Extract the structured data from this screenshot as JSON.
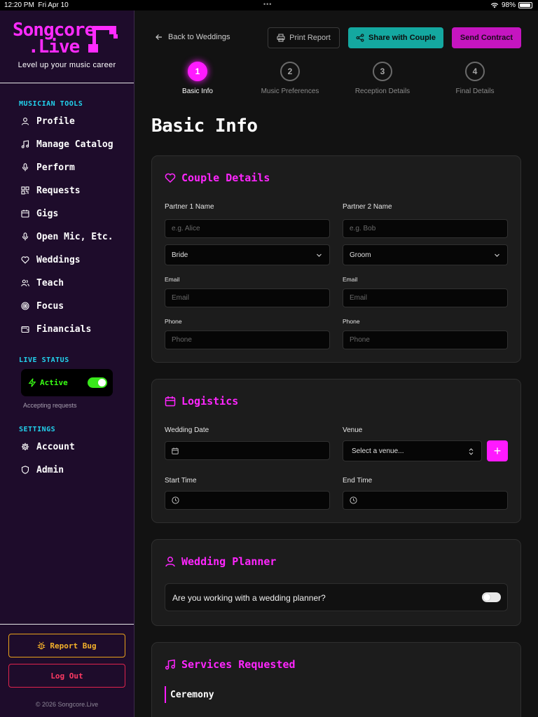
{
  "status_bar": {
    "time": "12:20 PM",
    "date": "Fri Apr 10",
    "battery": "98%",
    "battery_level": 0.98
  },
  "sidebar": {
    "logo_line1": "Songcore",
    "logo_line2": ".Live",
    "tagline": "Level up your music career",
    "musician_tools_heading": "MUSICIAN TOOLS",
    "items": [
      {
        "label": "Profile",
        "icon": "user-icon"
      },
      {
        "label": "Manage Catalog",
        "icon": "music-note-icon"
      },
      {
        "label": "Perform",
        "icon": "microphone-icon"
      },
      {
        "label": "Requests",
        "icon": "qr-code-icon"
      },
      {
        "label": "Gigs",
        "icon": "calendar-icon"
      },
      {
        "label": "Open Mic, Etc.",
        "icon": "microphone-icon"
      },
      {
        "label": "Weddings",
        "icon": "heart-icon"
      },
      {
        "label": "Teach",
        "icon": "users-icon"
      },
      {
        "label": "Focus",
        "icon": "target-icon"
      },
      {
        "label": "Financials",
        "icon": "wallet-icon"
      }
    ],
    "live_status_heading": "LIVE STATUS",
    "live_status_label": "Active",
    "live_status_on": true,
    "accepting_text": "Accepting requests",
    "settings_heading": "SETTINGS",
    "settings_items": [
      {
        "label": "Account",
        "icon": "gear-icon"
      },
      {
        "label": "Admin",
        "icon": "shield-icon"
      }
    ],
    "report_bug": "Report Bug",
    "log_out": "Log Out",
    "copyright": "© 2026 Songcore.Live"
  },
  "header": {
    "back_label": "Back to Weddings",
    "print_label": "Print Report",
    "share_label": "Share with Couple",
    "contract_label": "Send Contract"
  },
  "steps": [
    {
      "num": "1",
      "label": "Basic Info",
      "active": true
    },
    {
      "num": "2",
      "label": "Music Preferences",
      "active": false
    },
    {
      "num": "3",
      "label": "Reception Details",
      "active": false
    },
    {
      "num": "4",
      "label": "Final Details",
      "active": false
    }
  ],
  "page_title": "Basic Info",
  "couple": {
    "title": "Couple Details",
    "p1_label": "Partner 1 Name",
    "p2_label": "Partner 2 Name",
    "p1_placeholder": "e.g. Alice",
    "p2_placeholder": "e.g. Bob",
    "p1_role": "Bride",
    "p2_role": "Groom",
    "email_label": "Email",
    "email_placeholder": "Email",
    "phone_label": "Phone",
    "phone_placeholder": "Phone"
  },
  "logistics": {
    "title": "Logistics",
    "date_label": "Wedding Date",
    "venue_label": "Venue",
    "venue_placeholder": "Select a venue...",
    "add_label": "+",
    "start_label": "Start Time",
    "end_label": "End Time"
  },
  "planner": {
    "title": "Wedding Planner",
    "question": "Are you working with a wedding planner?",
    "enabled": false
  },
  "services": {
    "title": "Services Requested",
    "ceremony": "Ceremony"
  },
  "colors": {
    "accent": "#ff1aff",
    "teal": "#14a8a0",
    "cyan": "#22d3ee",
    "green": "#39ff14",
    "sidebar": "#1e0c2b"
  }
}
